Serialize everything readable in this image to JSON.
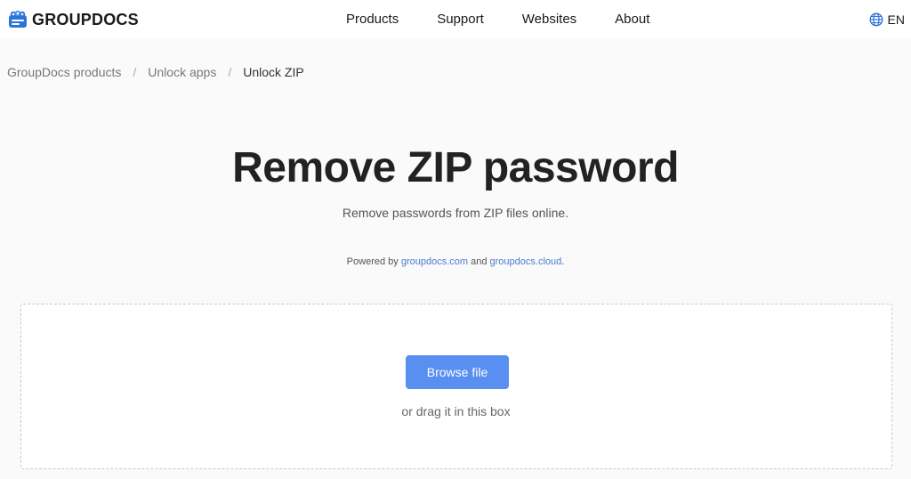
{
  "header": {
    "logo_text": "GROUPDOCS",
    "nav": [
      "Products",
      "Support",
      "Websites",
      "About"
    ],
    "lang": "EN"
  },
  "breadcrumb": {
    "items": [
      "GroupDocs products",
      "Unlock apps"
    ],
    "current": "Unlock ZIP",
    "separator": "/"
  },
  "main": {
    "title": "Remove ZIP password",
    "subtitle": "Remove passwords from ZIP files online.",
    "powered": {
      "prefix": "Powered by",
      "link1": "groupdocs.com",
      "conj": "and",
      "link2": "groupdocs.cloud",
      "suffix": "."
    }
  },
  "upload": {
    "button_label": "Browse file",
    "hint": "or drag it in this box"
  },
  "colors": {
    "accent": "#5a8ff2",
    "link": "#4a7bd0",
    "logo_blue": "#2b74d8"
  }
}
